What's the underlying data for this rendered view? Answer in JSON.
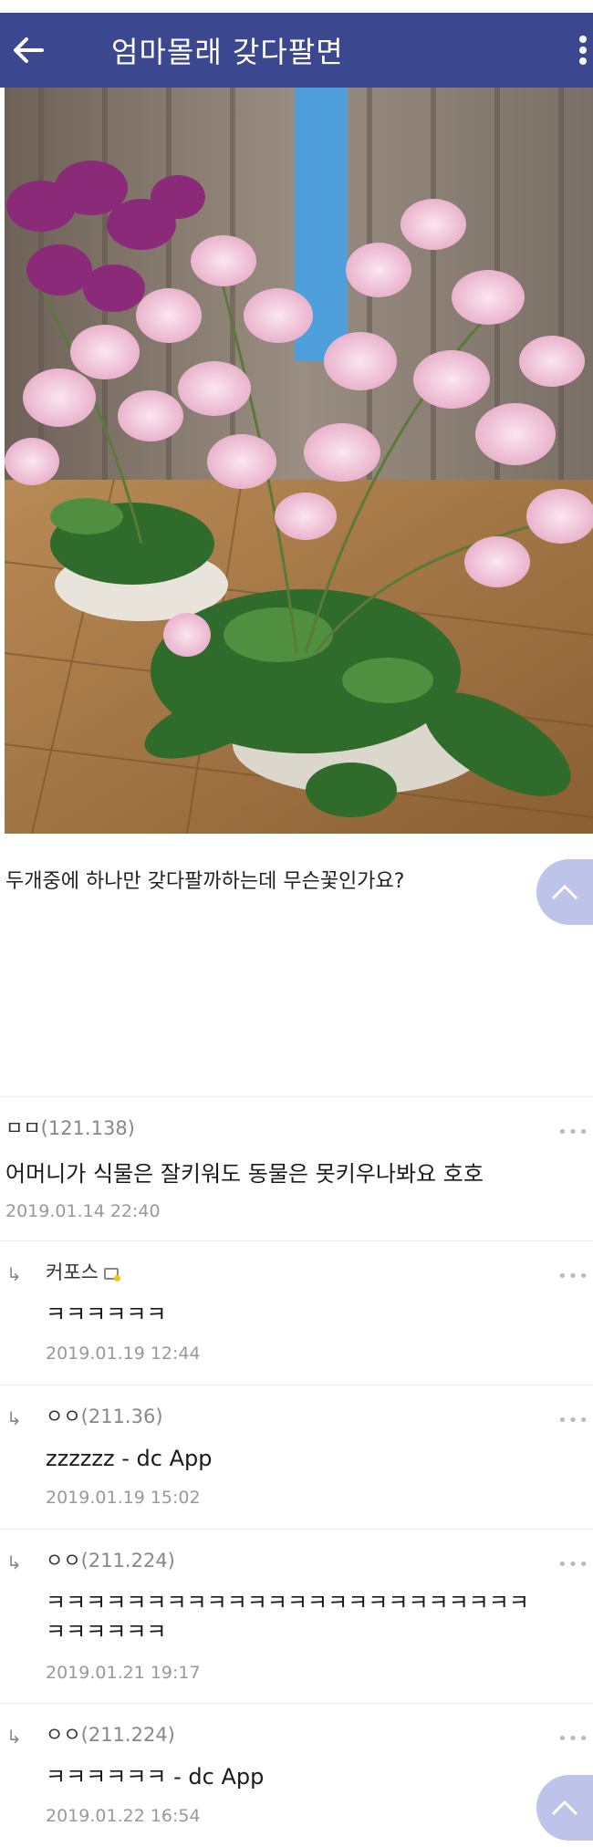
{
  "header": {
    "title": "엄마몰래 갖다팔면",
    "back_icon": "arrow-left-icon",
    "menu_icon": "more-vertical-icon",
    "bg_color": "#3b4890"
  },
  "post": {
    "body": "두개중에 하나만 갖다팔까하는데 무슨꽃인가요?"
  },
  "comments": [
    {
      "author": "ㅁㅁ",
      "ip": "(121.138)",
      "body": "어머니가 식물은 잘키워도 동물은 못키우나봐요 호호",
      "date": "2019.01.14 22:40",
      "reply": false,
      "badge": false
    },
    {
      "author": "커포스",
      "ip": "",
      "body": "ㅋㅋㅋㅋㅋㅋ",
      "date": "2019.01.19 12:44",
      "reply": true,
      "badge": true
    },
    {
      "author": "ㅇㅇ",
      "ip": "(211.36)",
      "body": "zzzzzz - dc App",
      "date": "2019.01.19 15:02",
      "reply": true,
      "badge": false
    },
    {
      "author": "ㅇㅇ",
      "ip": "(211.224)",
      "body": "ㅋㅋㅋㅋㅋㅋㅋㅋㅋㅋㅋㅋㅋㅋㅋㅋㅋㅋㅋㅋㅋㅋㅋㅋ",
      "body2": "ㅋㅋㅋㅋㅋㅋ",
      "date": "2019.01.21 19:17",
      "reply": true,
      "badge": false
    },
    {
      "author": "ㅇㅇ",
      "ip": "(211.224)",
      "body": "ㅋㅋㅋㅋㅋㅋ - dc App",
      "date": "2019.01.22 16:54",
      "reply": true,
      "badge": false
    }
  ]
}
